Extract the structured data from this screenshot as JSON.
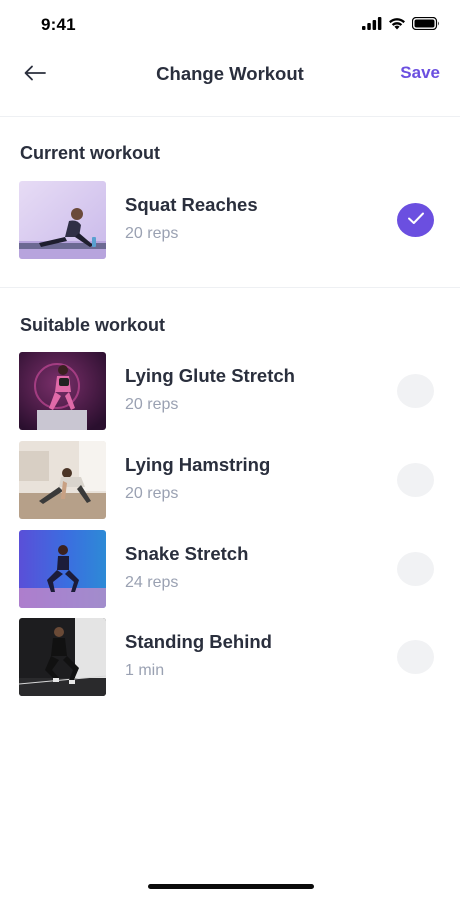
{
  "status_bar": {
    "time": "9:41",
    "icons": [
      "signal-icon",
      "wifi-icon",
      "battery-icon"
    ]
  },
  "nav": {
    "back_icon": "arrow-left-icon",
    "title": "Change Workout",
    "save_label": "Save"
  },
  "colors": {
    "accent": "#6b4fe0",
    "title_text": "#2a2f3d",
    "secondary_text": "#9aa1b2",
    "unselected_circle": "#f1f2f4",
    "divider": "#eef0f3"
  },
  "current": {
    "header": "Current workout",
    "items": [
      {
        "name": "Squat Reaches",
        "reps": "20 reps",
        "selected": true
      }
    ]
  },
  "suitable": {
    "header": "Suitable workout",
    "items": [
      {
        "name": "Lying Glute Stretch",
        "reps": "20 reps",
        "selected": false
      },
      {
        "name": "Lying Hamstring",
        "reps": "20 reps",
        "selected": false
      },
      {
        "name": "Snake Stretch",
        "reps": "24 reps",
        "selected": false
      },
      {
        "name": "Standing Behind",
        "reps": "1 min",
        "selected": false
      }
    ]
  }
}
